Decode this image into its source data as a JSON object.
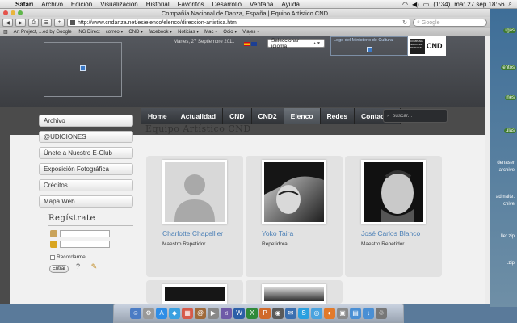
{
  "menubar": {
    "app": "Safari",
    "items": [
      "Archivo",
      "Edición",
      "Visualización",
      "Historial",
      "Favoritos",
      "Desarrollo",
      "Ventana",
      "Ayuda"
    ],
    "battery": "(1:34)",
    "clock": "mar 27 sep  18:56"
  },
  "browser": {
    "title": "Compañía Nacional de Danza, España | Equipo Artístico CND",
    "url": "http://www.cndanza.net/es/elenco/elenco/direccion-artistica.html",
    "search_placeholder": "Google",
    "bookmarks": [
      "Art Project, ...ed by Google",
      "ING Direct",
      "correo ▾",
      "CND ▾",
      "facebook ▾",
      "Noticias ▾",
      "Mac ▾",
      "Ocio ▾",
      "Viajes ▾"
    ]
  },
  "header": {
    "date": "Martes, 27 Septiembre 2011",
    "language_select": "Seleccionar idioma",
    "ministerio_alt": "Logo del Ministerio de Cultura",
    "cnd_small": "COMPAÑÍA NACIONAL DE DANZA",
    "cnd_big": "CND"
  },
  "nav": {
    "items": [
      "Home",
      "Actualidad",
      "CND",
      "CND2",
      "Elenco",
      "Redes",
      "Contactar"
    ],
    "active": "Elenco",
    "search_placeholder": "buscar..."
  },
  "sidebar": {
    "buttons": [
      "Archivo",
      "@UDICIONES",
      "Únete a Nuestro E-Club",
      "Exposición Fotográfica",
      "Créditos",
      "Mapa Web"
    ],
    "register_title": "Regístrate",
    "remember_label": "Recordarme",
    "enter_label": "Entrar"
  },
  "main": {
    "title": "Equipo Artístico CND",
    "cards": [
      {
        "name": "Charlotte Chapellier",
        "role": "Maestro Repetidor"
      },
      {
        "name": "Yoko Taira",
        "role": "Repetidora"
      },
      {
        "name": "José Carlos Blanco",
        "role": "Maestro Repetidor"
      }
    ]
  },
  "desktop": {
    "labels": [
      "rgas",
      "entos",
      "nes",
      "ulas",
      "denaser",
      "archive",
      "admaite.",
      "chive",
      "ller.zip",
      ".zip"
    ]
  }
}
